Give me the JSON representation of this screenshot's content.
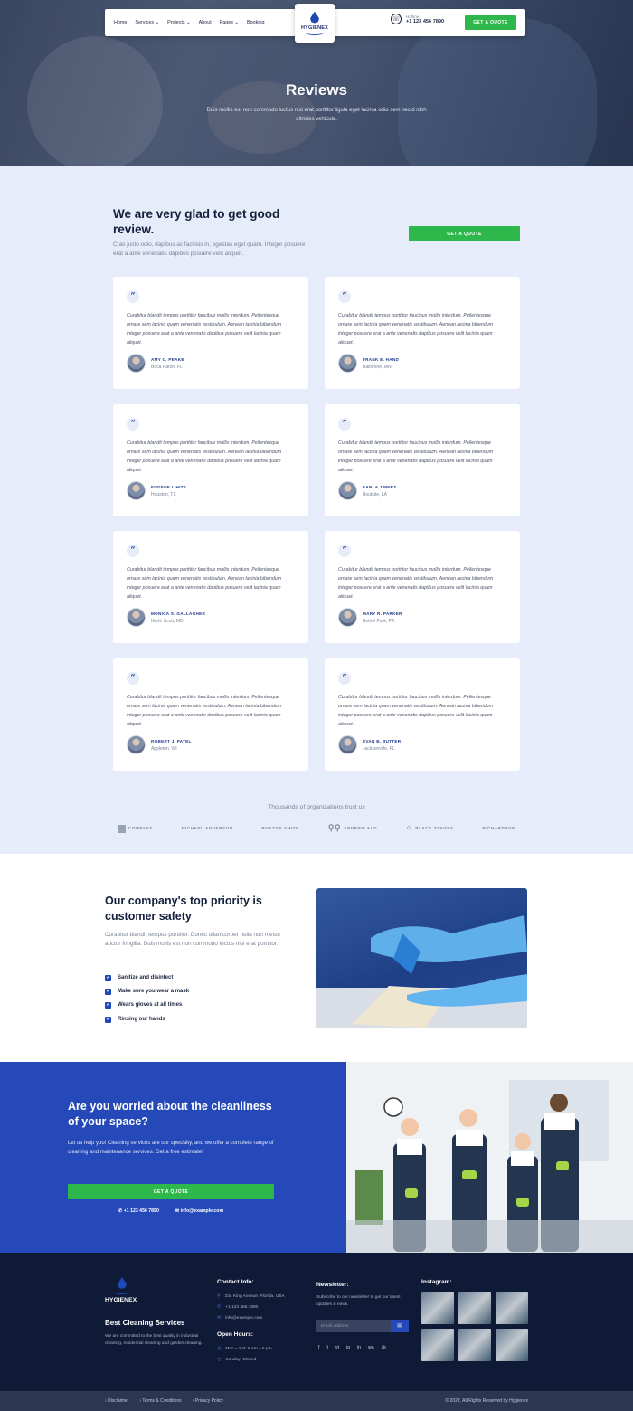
{
  "colors": {
    "brand_blue": "#2549b8",
    "cta_green": "#2eb84c",
    "dark_navy": "#0f1a36",
    "light_bg": "#e6ecfa"
  },
  "nav": {
    "items": [
      {
        "label": "Home",
        "caret": false
      },
      {
        "label": "Services",
        "caret": true
      },
      {
        "label": "Projects",
        "caret": true
      },
      {
        "label": "About",
        "caret": false
      },
      {
        "label": "Pages",
        "caret": true
      },
      {
        "label": "Booking",
        "caret": false
      }
    ],
    "logo": "HYGIENEX",
    "hotline_label": "Hotline",
    "hotline_number": "+1 123 456 7890",
    "quote_btn": "GET A QUOTE"
  },
  "hero": {
    "title": "Reviews",
    "subtitle": "Duis mollis est non commodo luctus nisi erat porttitor ligula eget lacinia odio sem necid nibh ultricies vehicula."
  },
  "reviews": {
    "heading": "We are very glad to get good review.",
    "intro": "Cras justo odio, dapibus ac facilisis in, egestas eget quam. Integer posuere erat a ante venenatis dapibus posuere velit aliquet.",
    "quote_btn": "GET A QUOTE",
    "quote_icon": "quote-icon",
    "items": [
      {
        "text": "Curabitur blandit tempus porttitor faucibus mollis interdum. Pellentesque ornare sem lacinia quam venenatis vestibulum. Aenean lacinia bibendum integer posuere erat a ante venenatis dapibus posuere velit lacinia quam aliquet.",
        "name": "AMY C. PEAKE",
        "location": "Boca Raton, FL"
      },
      {
        "text": "Curabitur blandit tempus porttitor faucibus mollis interdum. Pellentesque ornare sem lacinia quam venenatis vestibulum. Aenean lacinia bibendum integer posuere erat a ante venenatis dapibus posuere velit lacinia quam aliquet.",
        "name": "FRANK E. HAND",
        "location": "Baltimore, MN"
      },
      {
        "text": "Curabitur blandit tempus porttitor faucibus mollis interdum. Pellentesque ornare sem lacinia quam venenatis vestibulum. Aenean lacinia bibendum integer posuere erat a ante venenatis dapibus posuere velit lacinia quam aliquet.",
        "name": "EUGENE I. HITE",
        "location": "Houston, TX"
      },
      {
        "text": "Curabitur blandit tempus porttitor faucibus mollis interdum. Pellentesque ornare sem lacinia quam venenatis vestibulum. Aenean lacinia bibendum integer posuere erat a ante venenatis dapibus posuere velit lacinia quam aliquet.",
        "name": "EARLA JIMNEZ",
        "location": "Boutsite, LA"
      },
      {
        "text": "Curabitur blandit tempus porttitor faucibus mollis interdum. Pellentesque ornare sem lacinia quam venenatis vestibulum. Aenean lacinia bibendum integer posuere erat a ante venenatis dapibus posuere velit lacinia quam aliquet.",
        "name": "MONICA S. GALLAGHER",
        "location": "North Scott, MD"
      },
      {
        "text": "Curabitur blandit tempus porttitor faucibus mollis interdum. Pellentesque ornare sem lacinia quam venenatis vestibulum. Aenean lacinia bibendum integer posuere erat a ante venenatis dapibus posuere velit lacinia quam aliquet.",
        "name": "MARY R. PARKER",
        "location": "Bethel Park, PA"
      },
      {
        "text": "Curabitur blandit tempus porttitor faucibus mollis interdum. Pellentesque ornare sem lacinia quam venenatis vestibulum. Aenean lacinia bibendum integer posuere erat a ante venenatis dapibus posuere velit lacinia quam aliquet.",
        "name": "ROBERT J. PATEL",
        "location": "Appleton, WI"
      },
      {
        "text": "Curabitur blandit tempus porttitor faucibus mollis interdum. Pellentesque ornare sem lacinia quam venenatis vestibulum. Aenean lacinia bibendum integer posuere erat a ante venenatis dapibus posuere velit lacinia quam aliquet.",
        "name": "EVAN B. BUTTER",
        "location": "Jacksonville, FL"
      }
    ]
  },
  "trust": {
    "text": "Thousands of organizations trust us",
    "brands": [
      "COMPANY",
      "MICHAEL ANDERSON",
      "BOSTON SMITH",
      "ANDREW ALO",
      "BLACK STAGES",
      "RICHARDSON"
    ]
  },
  "safety": {
    "heading": "Our company's top priority is customer safety",
    "text": "Curabitur blandit tempus porttitor. Donec ullamcorper nulla non metus auctor fringilla. Duis mollis est non commodo luctus nisi erat porttitor.",
    "checks": [
      "Sanitize and disinfect",
      "Make sure you wear a mask",
      "Wears gloves at all times",
      "Rinsing our hands"
    ]
  },
  "cta": {
    "heading": "Are you worried about the cleanliness of your space?",
    "text": "Let us help you! Cleaning services are our specialty, and we offer a complete range of cleaning and maintenance services. Get a free estimate!",
    "button": "GET A QUOTE",
    "phone": "+1 123 456 7890",
    "email": "info@example.com"
  },
  "footer": {
    "logo": "HYGIENEX",
    "tagline": "Best Cleaning Services",
    "about": "We are committed to the best quality in industrial cleaning, residential cleaning and garden cleaning.",
    "contact_title": "Contact Info:",
    "address": "234 King Avenue, Florida, USA",
    "phone": "+1 123 456 7890",
    "email": "info@example.com",
    "hours_title": "Open Hours:",
    "hours_week": "Mon – Sat: 8 am – 5 pm",
    "hours_sunday": "Sunday: Closed",
    "newsletter_title": "Newsletter:",
    "newsletter_text": "Subscribe to our newsletter to get our latest updates & news.",
    "newsletter_placeholder": "Email address",
    "social": [
      "f",
      "t",
      "yt",
      "ig",
      "in",
      "wa",
      "sk"
    ],
    "instagram_title": "Instagram:",
    "bottom_links": [
      "Disclaimer",
      "Terms & Conditions",
      "Privacy Policy"
    ],
    "copyright": "© 2022. All Rights Reserved by Hygienex"
  }
}
